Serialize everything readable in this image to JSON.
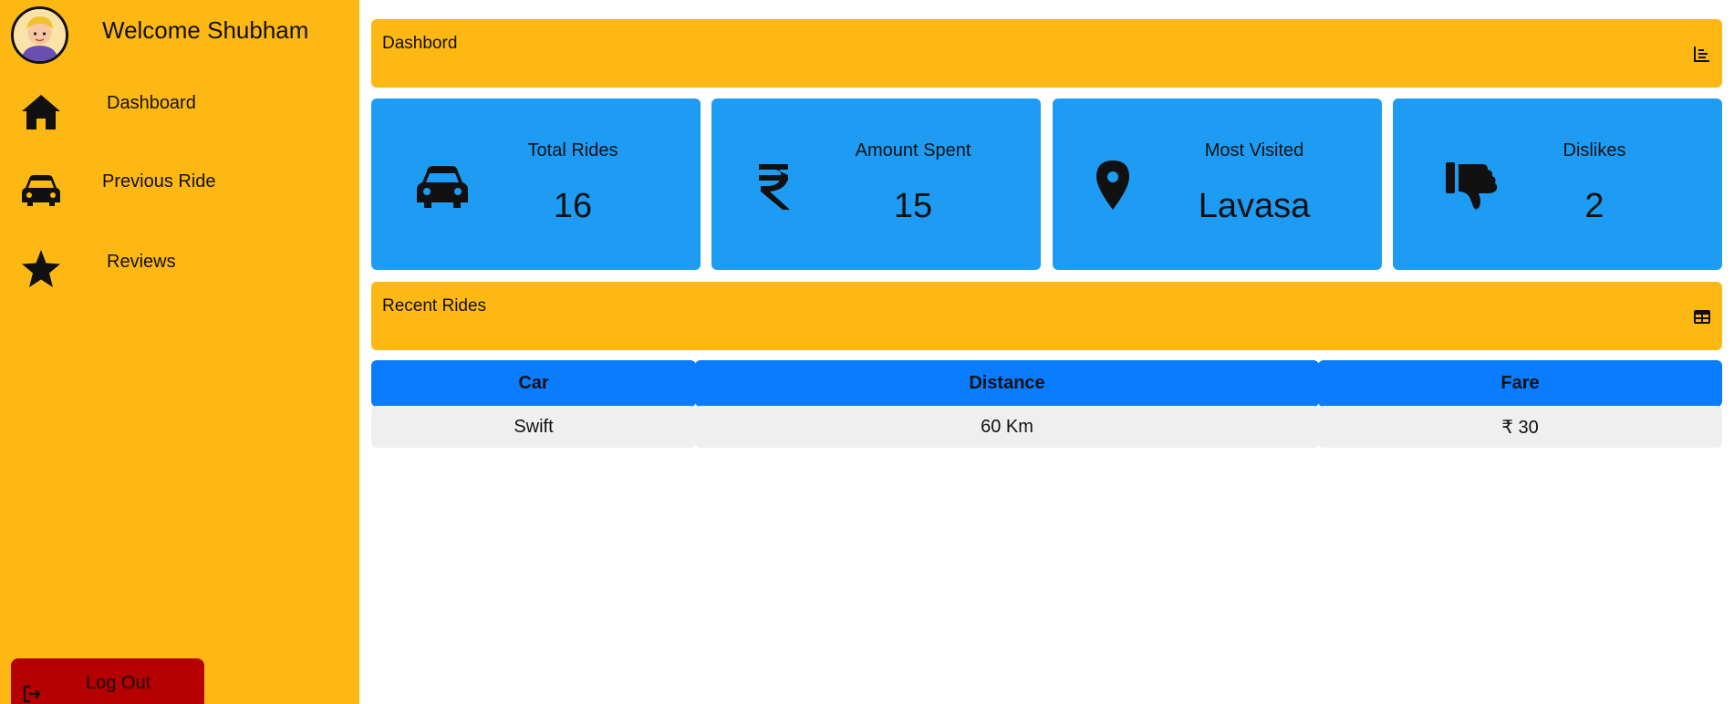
{
  "sidebar": {
    "welcome": "Welcome Shubham",
    "items": [
      {
        "label": "Dashboard",
        "icon": "home-icon"
      },
      {
        "label": "Previous Ride",
        "icon": "car-icon"
      },
      {
        "label": "Reviews",
        "icon": "star-icon"
      }
    ],
    "logout_label": "Log Out"
  },
  "dashboard": {
    "title": "Dashbord",
    "icon": "chart-icon"
  },
  "cards": [
    {
      "label": "Total Rides",
      "value": "16",
      "icon": "car-icon"
    },
    {
      "label": "Amount Spent",
      "value": "15",
      "icon": "rupee-icon"
    },
    {
      "label": "Most Visited",
      "value": "Lavasa",
      "icon": "location-pin-icon"
    },
    {
      "label": "Dislikes",
      "value": "2",
      "icon": "thumbs-down-icon"
    }
  ],
  "recent": {
    "title": "Recent Rides",
    "icon": "table-icon",
    "columns": [
      "Car",
      "Distance",
      "Fare"
    ],
    "rows": [
      [
        "Swift",
        "60 Km",
        "₹ 30"
      ]
    ]
  },
  "colors": {
    "sidebar_bg": "#fdb813",
    "card_bg": "#1e9cf3",
    "table_header_bg": "#0a7cff",
    "logout_bg": "#b40000",
    "row_bg": "#efefef"
  }
}
